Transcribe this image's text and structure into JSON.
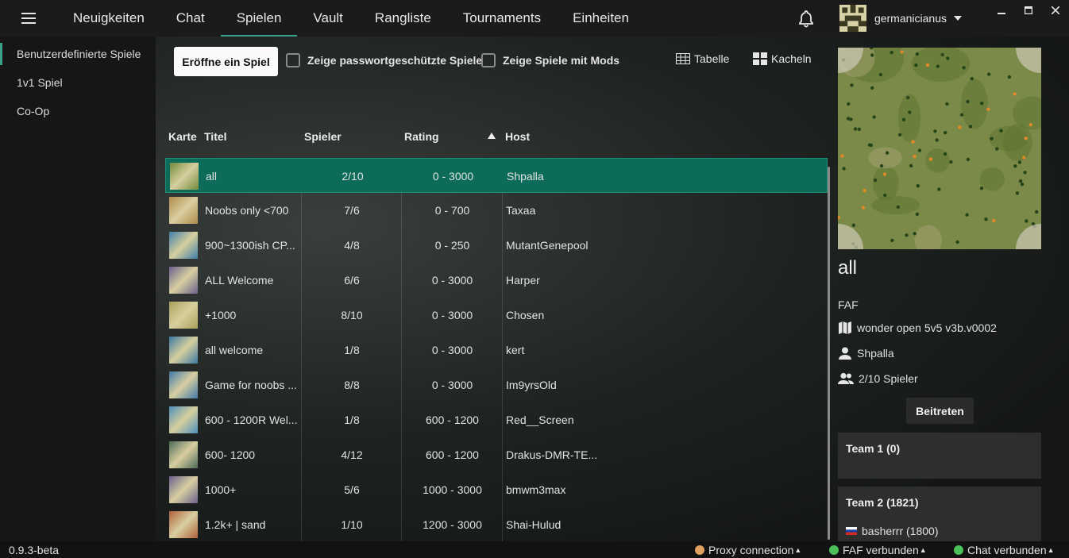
{
  "topbar": {
    "tabs": [
      {
        "label": "Neuigkeiten"
      },
      {
        "label": "Chat"
      },
      {
        "label": "Spielen"
      },
      {
        "label": "Vault"
      },
      {
        "label": "Rangliste"
      },
      {
        "label": "Tournaments"
      },
      {
        "label": "Einheiten"
      }
    ],
    "active_tab": "Spielen",
    "username": "germanicianus"
  },
  "sidebar": {
    "items": [
      {
        "label": "Benutzerdefinierte Spiele"
      },
      {
        "label": "1v1 Spiel"
      },
      {
        "label": "Co-Op"
      }
    ]
  },
  "toolbar": {
    "create_label": "Eröffne ein Spiel",
    "password_label": "Zeige passwortgeschützte Spiele",
    "mods_label": "Zeige Spiele mit Mods",
    "table_label": "Tabelle",
    "tiles_label": "Kacheln"
  },
  "table": {
    "headers": [
      "Karte",
      "Titel",
      "Spieler",
      "Rating",
      "Host"
    ],
    "rows": [
      {
        "title": "all",
        "players": "2/10",
        "rating": "0 - 3000",
        "host": "Shpalla",
        "map_color": "#6f8b3a"
      },
      {
        "title": "Noobs only <700",
        "players": "7/6",
        "rating": "0 - 700",
        "host": "Taxaa",
        "map_color": "#b08a4a"
      },
      {
        "title": "900~1300ish CP...",
        "players": "4/8",
        "rating": "0 - 250",
        "host": "MutantGenepool",
        "map_color": "#3e7fa8"
      },
      {
        "title": "ALL Welcome",
        "players": "6/6",
        "rating": "0 - 3000",
        "host": "Harper",
        "map_color": "#6a5f8f"
      },
      {
        "title": "+1000",
        "players": "8/10",
        "rating": "0 - 3000",
        "host": "Chosen",
        "map_color": "#a8a25a"
      },
      {
        "title": "all welcome",
        "players": "1/8",
        "rating": "0 - 3000",
        "host": "kert",
        "map_color": "#3a7aa0"
      },
      {
        "title": "Game for noobs ...",
        "players": "8/8",
        "rating": "0 - 3000",
        "host": "Im9yrsOld",
        "map_color": "#3f78a6"
      },
      {
        "title": "600 - 1200R Wel...",
        "players": "1/8",
        "rating": "600 - 1200",
        "host": "Red__Screen",
        "map_color": "#4a90b8"
      },
      {
        "title": "600- 1200",
        "players": "4/12",
        "rating": "600 - 1200",
        "host": "Drakus-DMR-TE...",
        "map_color": "#4f6a58"
      },
      {
        "title": "1000+",
        "players": "5/6",
        "rating": "1000 - 3000",
        "host": "bmwm3max",
        "map_color": "#6a5f8f"
      },
      {
        "title": "1.2k+ | sand",
        "players": "1/10",
        "rating": "1200 - 3000",
        "host": "Shai-Hulud",
        "map_color": "#b0603a"
      }
    ]
  },
  "detail": {
    "title": "all",
    "featured_mod": "FAF",
    "map_name": "wonder open 5v5 v3b.v0002",
    "host": "Shpalla",
    "players": "2/10 Spieler",
    "join_label": "Beitreten",
    "teams": [
      {
        "title": "Team 1 (0)",
        "players": []
      },
      {
        "title": "Team 2 (1821)",
        "players": [
          {
            "name": "basherrr (1800)",
            "flag": "ru"
          }
        ]
      }
    ]
  },
  "statusbar": {
    "version": "0.9.3-beta",
    "proxy_label": "Proxy connection",
    "proxy_color": "#e0a060",
    "faf_label": "FAF verbunden",
    "faf_color": "#4cc05a",
    "chat_label": "Chat verbunden",
    "chat_color": "#4cc05a"
  },
  "colors": {
    "accent": "#3aa08b",
    "selected_row": "#0c6b59"
  }
}
